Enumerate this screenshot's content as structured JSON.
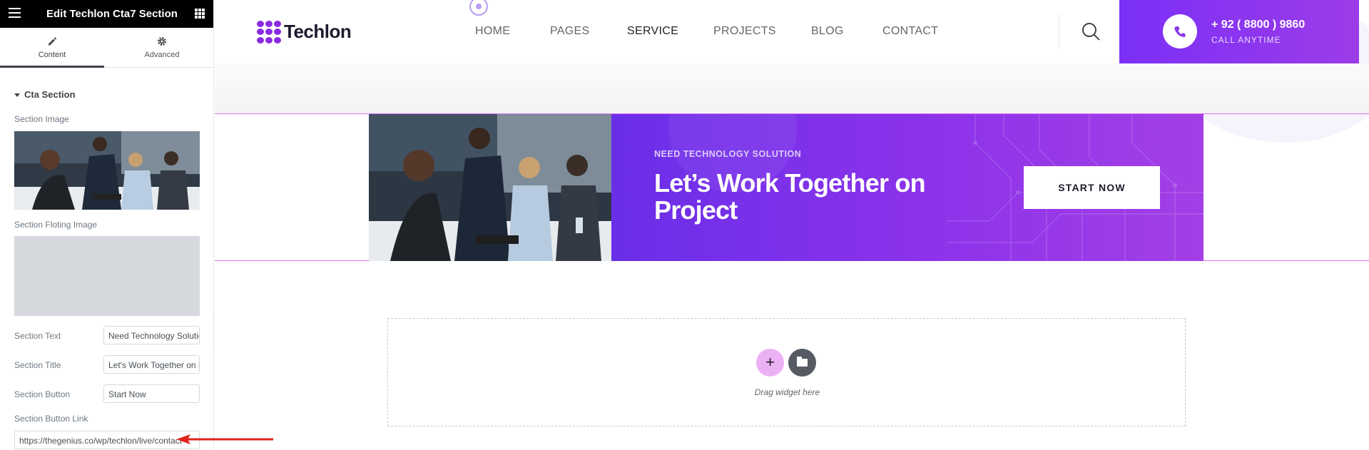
{
  "sidebar": {
    "title": "Edit Techlon Cta7 Section",
    "tabs": [
      {
        "label": "Content",
        "icon": "pencil-icon"
      },
      {
        "label": "Advanced",
        "icon": "gear-icon"
      }
    ],
    "section": {
      "title": "Cta Section",
      "controls": {
        "section_image_label": "Section Image",
        "floating_image_label": "Section Floting Image",
        "text_label": "Section Text",
        "text_value": "Need Technology Solution",
        "title_label": "Section Title",
        "title_value": "Let's Work Together on Project",
        "button_label": "Section Button",
        "button_value": "Start Now",
        "link_label": "Section Button Link",
        "link_value": "https://thegenius.co/wp/techlon/live/contact"
      }
    }
  },
  "site": {
    "logo_text": "Techlon",
    "nav": [
      {
        "label": "HOME"
      },
      {
        "label": "PAGES"
      },
      {
        "label": "SERVICE"
      },
      {
        "label": "PROJECTS"
      },
      {
        "label": "BLOG"
      },
      {
        "label": "CONTACT"
      }
    ],
    "active_nav": "SERVICE",
    "phone_number": "+ 92 ( 8800 ) 9860",
    "phone_sub": "CALL ANYTIME",
    "brand_color": "#7b2ff7"
  },
  "cta": {
    "eyebrow": "NEED TECHNOLOGY SOLUTION",
    "title": "Let’s Work Together on Project",
    "button": "START NOW"
  },
  "drop_zone": {
    "text": "Drag widget here",
    "add_label": "+"
  }
}
